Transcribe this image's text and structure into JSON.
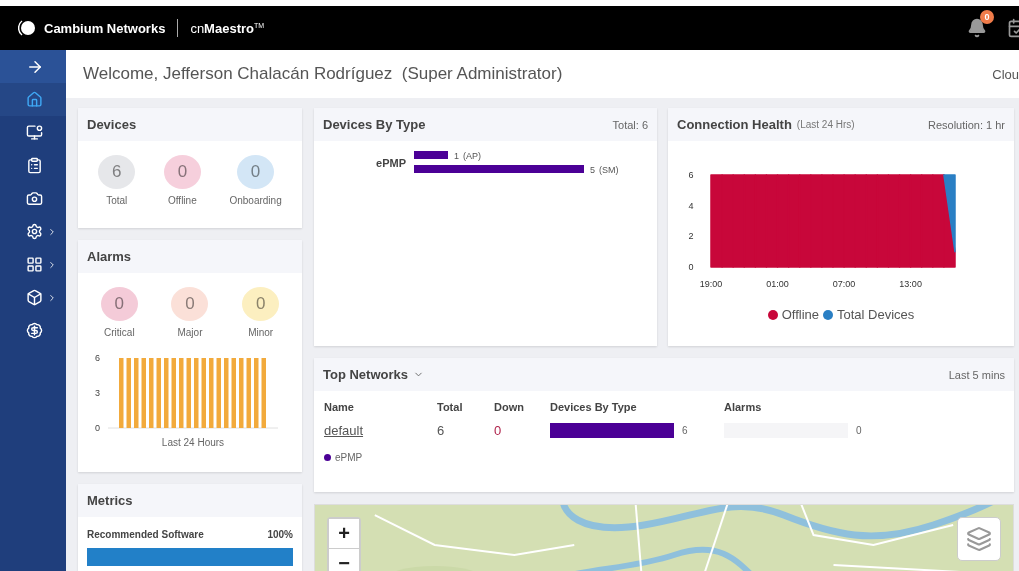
{
  "header": {
    "brand": "Cambium Networks",
    "product": "cn**Maestro**$^{TM}$",
    "notifications": "0"
  },
  "sidebar": {
    "items": [
      {
        "selected": false,
        "submenu": false
      },
      {
        "selected": true,
        "submenu": false
      },
      {
        "selected": false,
        "submenu": false
      },
      {
        "selected": false,
        "submenu": false
      },
      {
        "selected": false,
        "submenu": false
      },
      {
        "selected": false,
        "submenu": true
      },
      {
        "selected": false,
        "submenu": true
      },
      {
        "selected": false,
        "submenu": true
      },
      {
        "selected": false,
        "submenu": false
      }
    ]
  },
  "welcome": {
    "text": "Welcome, Jefferson Chalacán Rodríguez  (Super Administrator)",
    "right": "Clou"
  },
  "devices": {
    "title": "Devices",
    "stats": [
      {
        "value": "6",
        "label": "Total",
        "color": "#e6e7ea"
      },
      {
        "value": "0",
        "label": "Offline",
        "color": "#f6cfdc"
      },
      {
        "value": "0",
        "label": "Onboarding",
        "color": "#d3e6f6"
      }
    ]
  },
  "alarms": {
    "title": "Alarms",
    "stats": [
      {
        "value": "0",
        "label": "Critical",
        "color": "#f4cbd8"
      },
      {
        "value": "0",
        "label": "Major",
        "color": "#fbe0d8"
      },
      {
        "value": "0",
        "label": "Minor",
        "color": "#fcefc0"
      }
    ],
    "chart_data": {
      "type": "bar",
      "xlabel": "Last 24 Hours",
      "series": [
        {
          "color": "#f2aa3c",
          "values": [
            6,
            6,
            6,
            6,
            6,
            6,
            6,
            6,
            6,
            6,
            6,
            6,
            6,
            6,
            6,
            6,
            6,
            6,
            6,
            6
          ]
        }
      ],
      "ylim": [
        0,
        6
      ],
      "yticks": [
        0,
        3,
        6
      ]
    }
  },
  "metrics": {
    "title": "Metrics",
    "items": [
      {
        "label": "Recommended Software",
        "reading": "100%",
        "level": 1
      }
    ]
  },
  "devices_by_type": {
    "title": "Devices By Type",
    "total": "Total: 6",
    "chart_data": {
      "type": "bar",
      "orientation": "horizontal",
      "ylabel": "ePMP",
      "categories": [
        "(AP)",
        "(SM)"
      ],
      "series": [
        {
          "color": "#4b0096",
          "values": [
            1,
            5
          ]
        }
      ],
      "data_labels": true
    }
  },
  "connection_health": {
    "title": "Connection Health",
    "subtitle": "(Last 24 Hrs)",
    "resolution": "Resolution: 1 hr",
    "chart_data": {
      "type": "area",
      "categories": [
        "19:00",
        null,
        null,
        null,
        null,
        null,
        "01:00",
        null,
        null,
        null,
        null,
        null,
        "07:00",
        null,
        null,
        null,
        null,
        null,
        "13:00",
        null,
        null,
        null,
        null
      ],
      "series": [
        {
          "name": "Offline",
          "color": "#c8073a",
          "values": [
            6,
            6,
            6,
            6,
            6,
            6,
            6,
            6,
            6,
            6,
            6,
            6,
            6,
            6,
            6,
            6,
            6,
            6,
            6,
            6,
            6,
            6,
            1
          ]
        },
        {
          "name": "Total Devices",
          "color": "#2a7fc4",
          "values": [
            null,
            null,
            null,
            null,
            null,
            null,
            null,
            null,
            null,
            null,
            null,
            null,
            null,
            null,
            null,
            null,
            null,
            null,
            null,
            null,
            null,
            6,
            6
          ]
        }
      ],
      "ylim": [
        0,
        6
      ],
      "yticks": [
        0,
        2,
        4,
        6
      ],
      "stacked": false
    }
  },
  "top_networks": {
    "title": "Top Networks",
    "period": "Last 5 mins",
    "columns": [
      "Name",
      "Total",
      "Down",
      "Devices By Type",
      "Alarms"
    ],
    "rows": [
      {
        "name": "default",
        "total": "6",
        "down": "0",
        "devices": {
          "level": 1,
          "reading": "6"
        },
        "alarms": {
          "level": 0,
          "reading": "0"
        }
      }
    ],
    "legend": [
      {
        "label": "ePMP",
        "color": "#4b0096"
      }
    ]
  },
  "map": {
    "kind": "picture",
    "zoom_in": "+",
    "zoom_out": "−"
  }
}
